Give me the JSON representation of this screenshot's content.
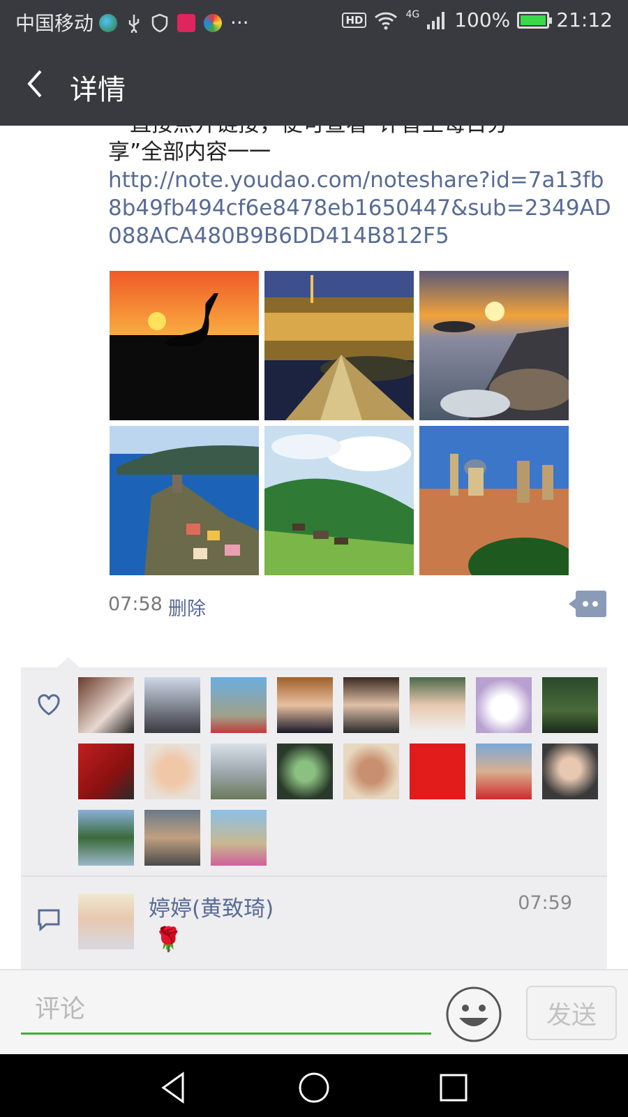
{
  "status_bar": {
    "carrier": "中国移动",
    "more": "···",
    "network": "4G",
    "hd": "HD",
    "battery": "100%",
    "time": "21:12"
  },
  "nav": {
    "title": "详情"
  },
  "post": {
    "text_clipped": "一直接点开链接，便可查看“评音王每日分",
    "text_line2": "享”全部内容一一",
    "link": "http://note.youdao.com/noteshare?id=7a13fb8b49fb494cf6e8478eb1650447&sub=2349AD088ACA480B9B6DD414B812F5",
    "photos": [
      "heron-sunset-photo",
      "louvre-night-photo",
      "coast-sunset-photo",
      "vernazza-coast-photo",
      "mountain-village-photo",
      "hill-town-photo"
    ],
    "time": "07:58",
    "delete_label": "删除"
  },
  "likes": {
    "count": 19
  },
  "comments": [
    {
      "author": "婷婷(黄致琦)",
      "time": "07:59",
      "content": "🌹"
    }
  ],
  "comment_bar": {
    "placeholder": "评论",
    "send_label": "发送"
  },
  "colors": {
    "topbar": "#393a3f",
    "link": "#576b95",
    "panel": "#eeeef0",
    "accent": "#3cb034"
  }
}
